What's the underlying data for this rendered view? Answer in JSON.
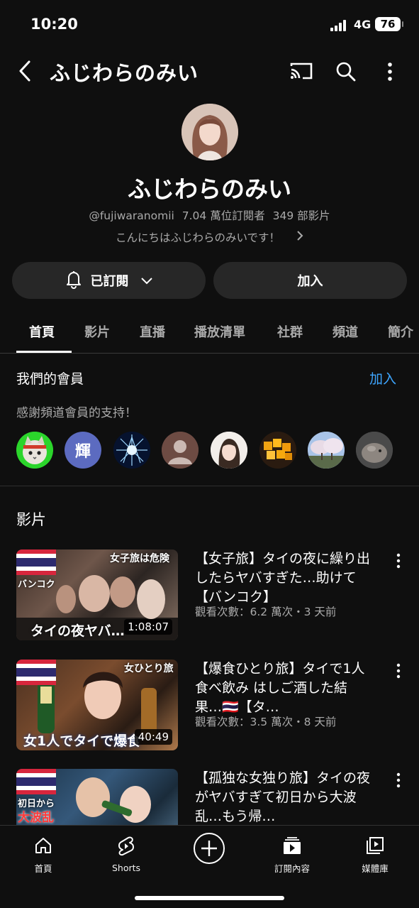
{
  "status": {
    "time": "10:20",
    "network": "4G",
    "battery": "76"
  },
  "header": {
    "title": "ふじわらのみい"
  },
  "channel": {
    "name": "ふじわらのみい",
    "handle": "@fujiwaranomii",
    "subscribers": "7.04 萬位訂閱者",
    "video_count": "349 部影片",
    "description": "こんにちはふじわらのみいです！"
  },
  "actions": {
    "subscribed_label": "已訂閱",
    "join_label": "加入"
  },
  "tabs": [
    {
      "label": "首頁",
      "active": true
    },
    {
      "label": "影片",
      "active": false
    },
    {
      "label": "直播",
      "active": false
    },
    {
      "label": "播放清單",
      "active": false
    },
    {
      "label": "社群",
      "active": false
    },
    {
      "label": "頻道",
      "active": false
    },
    {
      "label": "簡介",
      "active": false
    }
  ],
  "members": {
    "title": "我們的會員",
    "join_label": "加入",
    "thanks": "感謝頻道會員的支持！",
    "avatars": [
      {
        "name": "cat-avatar"
      },
      {
        "name": "glyph-avatar",
        "letter": "輝"
      },
      {
        "name": "blue-light-avatar"
      },
      {
        "name": "default-avatar"
      },
      {
        "name": "woman-avatar"
      },
      {
        "name": "mango-avatar"
      },
      {
        "name": "cherry-blossom-avatar"
      },
      {
        "name": "animal-avatar"
      }
    ]
  },
  "videos_section": {
    "title": "影片"
  },
  "videos": [
    {
      "title": "【女子旅】タイの夜に繰り出したらヤバすぎた…助けて【バンコク】",
      "meta": "觀看次數：6.2 萬次・3 天前",
      "duration": "1:08:07",
      "thumb_text_top": "女子旅は危険",
      "thumb_text_side": "バンコク",
      "thumb_text_bottom": "タイの夜ヤバ…"
    },
    {
      "title": "【爆食ひとり旅】タイで1人食べ飲み はしご酒した結果…🇹🇭【タ…",
      "meta": "觀看次數：3.5 萬次・8 天前",
      "duration": "40:49",
      "thumb_text_top": "女ひとり旅",
      "thumb_text_side": "",
      "thumb_text_bottom": "女1人でタイで爆食"
    },
    {
      "title": "【孤独な女独り旅】タイの夜がヤバすぎて初日から大波乱…もう帰…",
      "meta": "",
      "duration": "",
      "thumb_text_top": "",
      "thumb_text_side": "初日から",
      "thumb_text_bottom": "大波乱"
    }
  ],
  "bottom_nav": [
    {
      "label": "首頁",
      "icon": "home-icon"
    },
    {
      "label": "Shorts",
      "icon": "shorts-icon"
    },
    {
      "label": "",
      "icon": "create-icon"
    },
    {
      "label": "訂閱內容",
      "icon": "subscriptions-icon"
    },
    {
      "label": "媒體庫",
      "icon": "library-icon"
    }
  ]
}
